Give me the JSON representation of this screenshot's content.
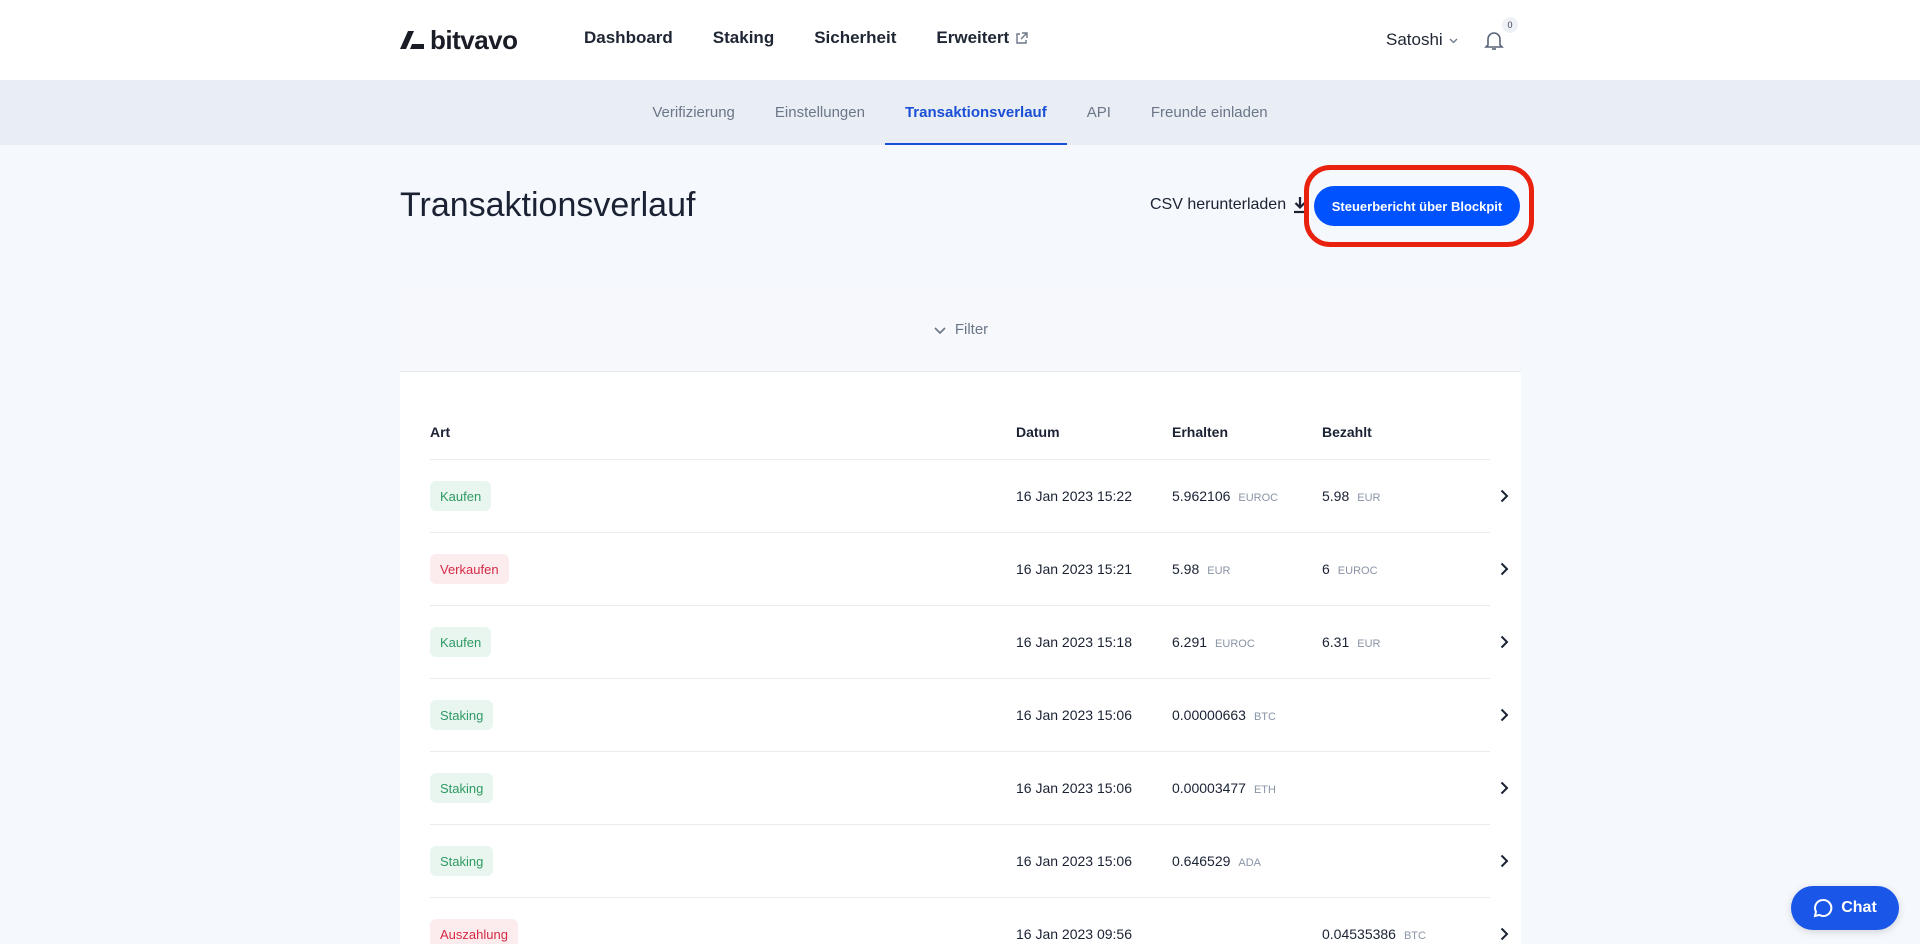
{
  "brand": {
    "name": "bitvavo"
  },
  "nav": {
    "items": [
      {
        "label": "Dashboard"
      },
      {
        "label": "Staking"
      },
      {
        "label": "Sicherheit"
      },
      {
        "label": "Erweitert"
      }
    ],
    "user_name": "Satoshi",
    "notification_count": "0"
  },
  "tabs": [
    {
      "label": "Verifizierung"
    },
    {
      "label": "Einstellungen"
    },
    {
      "label": "Transaktionsverlauf",
      "active": true
    },
    {
      "label": "API"
    },
    {
      "label": "Freunde einladen"
    }
  ],
  "page": {
    "title": "Transaktionsverlauf",
    "csv_label": "CSV herunterladen",
    "report_label": "Steuerbericht über Blockpit"
  },
  "filter": {
    "label": "Filter"
  },
  "table": {
    "headers": {
      "type": "Art",
      "date": "Datum",
      "received": "Erhalten",
      "paid": "Bezahlt"
    },
    "rows": [
      {
        "type": "Kaufen",
        "tone": "green",
        "date": "16 Jan 2023 15:22",
        "received": "5.962106",
        "received_cur": "EUROC",
        "paid": "5.98",
        "paid_cur": "EUR"
      },
      {
        "type": "Verkaufen",
        "tone": "red",
        "date": "16 Jan 2023 15:21",
        "received": "5.98",
        "received_cur": "EUR",
        "paid": "6",
        "paid_cur": "EUROC"
      },
      {
        "type": "Kaufen",
        "tone": "green",
        "date": "16 Jan 2023 15:18",
        "received": "6.291",
        "received_cur": "EUROC",
        "paid": "6.31",
        "paid_cur": "EUR"
      },
      {
        "type": "Staking",
        "tone": "green",
        "date": "16 Jan 2023 15:06",
        "received": "0.00000663",
        "received_cur": "BTC",
        "paid": "",
        "paid_cur": ""
      },
      {
        "type": "Staking",
        "tone": "green",
        "date": "16 Jan 2023 15:06",
        "received": "0.00003477",
        "received_cur": "ETH",
        "paid": "",
        "paid_cur": ""
      },
      {
        "type": "Staking",
        "tone": "green",
        "date": "16 Jan 2023 15:06",
        "received": "0.646529",
        "received_cur": "ADA",
        "paid": "",
        "paid_cur": ""
      },
      {
        "type": "Auszahlung",
        "tone": "red",
        "date": "16 Jan 2023 09:56",
        "received": "",
        "received_cur": "",
        "paid": "0.04535386",
        "paid_cur": "BTC"
      }
    ]
  },
  "chat": {
    "label": "Chat"
  },
  "colors": {
    "accent": "#0052ff",
    "highlight": "#e8220f",
    "positive": "#2f9a63",
    "negative": "#d42a45"
  }
}
